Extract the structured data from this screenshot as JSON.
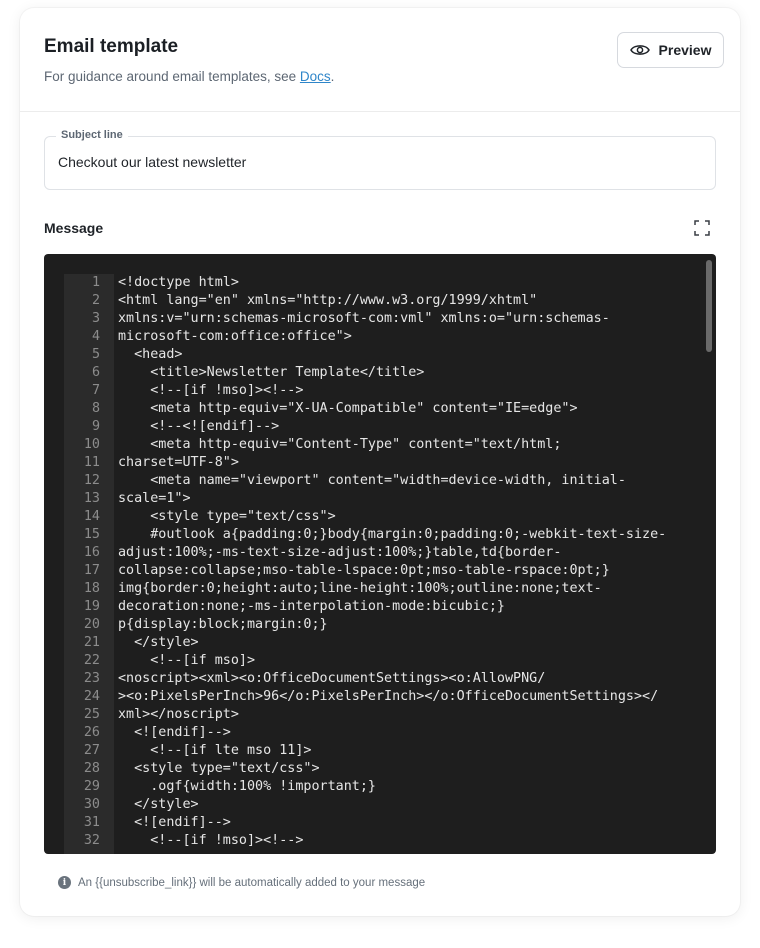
{
  "header": {
    "title": "Email template",
    "subtitle_prefix": "For guidance around email templates, see ",
    "docs_link": "Docs",
    "subtitle_suffix": ".",
    "preview_label": "Preview"
  },
  "subject": {
    "label": "Subject line",
    "value": "Checkout our latest newsletter"
  },
  "message": {
    "label": "Message",
    "code_lines": [
      "<!doctype html>",
      "<html lang=\"en\" xmlns=\"http://www.w3.org/1999/xhtml\"",
      "xmlns:v=\"urn:schemas-microsoft-com:vml\" xmlns:o=\"urn:schemas-",
      "microsoft-com:office:office\">",
      "  <head>",
      "    <title>Newsletter Template</title>",
      "    <!--[if !mso]><!-->",
      "    <meta http-equiv=\"X-UA-Compatible\" content=\"IE=edge\">",
      "    <!--<![endif]-->",
      "    <meta http-equiv=\"Content-Type\" content=\"text/html;",
      "charset=UTF-8\">",
      "    <meta name=\"viewport\" content=\"width=device-width, initial-",
      "scale=1\">",
      "    <style type=\"text/css\">",
      "    #outlook a{padding:0;}body{margin:0;padding:0;-webkit-text-size-",
      "adjust:100%;-ms-text-size-adjust:100%;}table,td{border-",
      "collapse:collapse;mso-table-lspace:0pt;mso-table-rspace:0pt;}",
      "img{border:0;height:auto;line-height:100%;outline:none;text-",
      "decoration:none;-ms-interpolation-mode:bicubic;}",
      "p{display:block;margin:0;}",
      "  </style>",
      "    <!--[if mso]>",
      "<noscript><xml><o:OfficeDocumentSettings><o:AllowPNG/",
      "><o:PixelsPerInch>96</o:PixelsPerInch></o:OfficeDocumentSettings></",
      "xml></noscript>",
      "  <![endif]-->",
      "    <!--[if lte mso 11]>",
      "  <style type=\"text/css\">",
      "    .ogf{width:100% !important;}",
      "  </style>",
      "  <![endif]-->",
      "    <!--[if !mso]><!-->"
    ]
  },
  "footnote": {
    "icon_glyph": "i",
    "text": "An {{unsubscribe_link}} will be automatically added to your message"
  },
  "colors": {
    "link": "#2f86c9",
    "editor_bg": "#1e1e1e",
    "gutter_bg": "#2b2b2b"
  }
}
